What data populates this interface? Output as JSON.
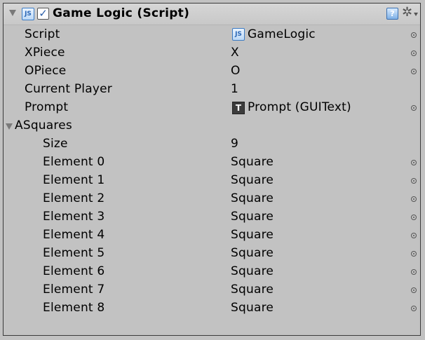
{
  "component": {
    "title": "Game Logic (Script)",
    "enabled": true,
    "js_badge": "JS"
  },
  "fields": {
    "script": {
      "label": "Script",
      "value": "GameLogic"
    },
    "xpiece": {
      "label": "XPiece",
      "value": "X"
    },
    "opiece": {
      "label": "OPiece",
      "value": "O"
    },
    "current_player": {
      "label": "Current Player",
      "value": "1"
    },
    "prompt": {
      "label": "Prompt",
      "value": "Prompt (GUIText)",
      "icon": "T"
    }
  },
  "asquares": {
    "label": "ASquares",
    "size_label": "Size",
    "size": "9",
    "elements": [
      {
        "label": "Element 0",
        "value": "Square"
      },
      {
        "label": "Element 1",
        "value": "Square"
      },
      {
        "label": "Element 2",
        "value": "Square"
      },
      {
        "label": "Element 3",
        "value": "Square"
      },
      {
        "label": "Element 4",
        "value": "Square"
      },
      {
        "label": "Element 5",
        "value": "Square"
      },
      {
        "label": "Element 6",
        "value": "Square"
      },
      {
        "label": "Element 7",
        "value": "Square"
      },
      {
        "label": "Element 8",
        "value": "Square"
      }
    ]
  },
  "icons": {
    "foldout": "triangle-down",
    "script": "js-icon",
    "help": "help-icon",
    "settings": "gear-icon",
    "object_picker": "object-picker-icon"
  }
}
